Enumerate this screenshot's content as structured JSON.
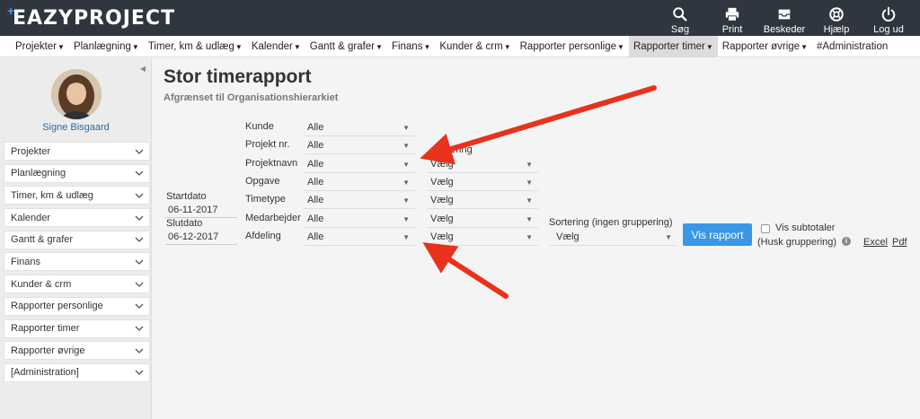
{
  "app": {
    "logo": "EAZYPROJECT",
    "logo_mark": "+"
  },
  "topbar": {
    "tools": [
      {
        "label": "Søg",
        "icon": "search-icon"
      },
      {
        "label": "Print",
        "icon": "printer-icon"
      },
      {
        "label": "Beskeder",
        "icon": "inbox-icon"
      },
      {
        "label": "Hjælp",
        "icon": "lifebuoy-icon"
      },
      {
        "label": "Log ud",
        "icon": "power-icon"
      }
    ]
  },
  "menu": {
    "items": [
      {
        "label": "Projekter"
      },
      {
        "label": "Planlægning"
      },
      {
        "label": "Timer, km & udlæg"
      },
      {
        "label": "Kalender"
      },
      {
        "label": "Gantt & grafer"
      },
      {
        "label": "Finans"
      },
      {
        "label": "Kunder & crm"
      },
      {
        "label": "Rapporter personlige"
      },
      {
        "label": "Rapporter timer"
      },
      {
        "label": "Rapporter øvrige"
      },
      {
        "label": "#Administration"
      }
    ],
    "active_index": 8
  },
  "sidebar": {
    "user": "Signe Bisgaard",
    "items": [
      {
        "label": "Projekter"
      },
      {
        "label": "Planlægning"
      },
      {
        "label": "Timer, km & udlæg"
      },
      {
        "label": "Kalender"
      },
      {
        "label": "Gantt & grafer"
      },
      {
        "label": "Finans"
      },
      {
        "label": "Kunder & crm"
      },
      {
        "label": "Rapporter personlige"
      },
      {
        "label": "Rapporter timer"
      },
      {
        "label": "Rapporter øvrige"
      },
      {
        "label": "[Administration]"
      }
    ]
  },
  "page": {
    "title": "Stor timerapport",
    "subtitle": "Afgrænset til Organisationshierarkiet"
  },
  "form": {
    "startdato_label": "Startdato",
    "startdato": "06-11-2017",
    "slutdato_label": "Slutdato",
    "slutdato": "06-12-2017",
    "filters": [
      {
        "label": "Kunde",
        "value": "Alle"
      },
      {
        "label": "Projekt nr.",
        "value": "Alle"
      },
      {
        "label": "Projektnavn",
        "value": "Alle"
      },
      {
        "label": "Opgave",
        "value": "Alle"
      },
      {
        "label": "Timetype",
        "value": "Alle"
      },
      {
        "label": "Medarbejder",
        "value": "Alle"
      },
      {
        "label": "Afdeling",
        "value": "Alle"
      }
    ],
    "grouping_label": "ppering",
    "grouping": [
      "Vælg",
      "Vælg",
      "Vælg",
      "Vælg",
      "Vælg"
    ],
    "sort_label": "Sortering (ingen gruppering)",
    "sort_value": "Vælg",
    "submit": "Vis rapport",
    "subtotal_label": "Vis subtotaler",
    "subtotal_note": "(Husk gruppering)",
    "excel": "Excel",
    "pdf": "Pdf"
  },
  "colors": {
    "topbar": "#2f3640",
    "accent": "#3a97e5",
    "arrow": "#e8321e",
    "link": "#2a6aa0"
  }
}
